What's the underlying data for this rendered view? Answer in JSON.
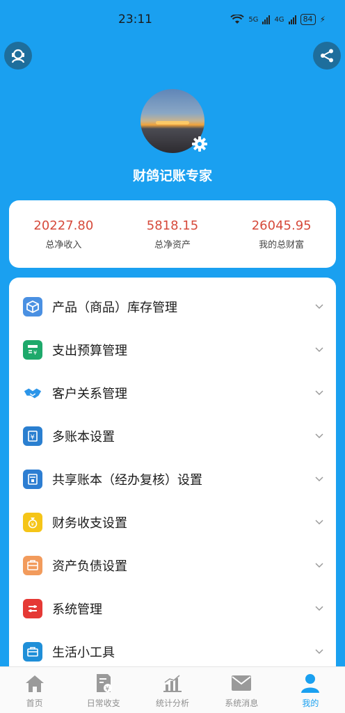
{
  "status_bar": {
    "time": "23:11",
    "net1": "5G",
    "net2": "4G",
    "battery": "84"
  },
  "profile": {
    "name": "财鸽记账专家"
  },
  "stats": [
    {
      "value": "20227.80",
      "label": "总净收入"
    },
    {
      "value": "5818.15",
      "label": "总净资产"
    },
    {
      "value": "26045.95",
      "label": "我的总财富"
    }
  ],
  "menu": [
    {
      "label": "产品（商品）库存管理",
      "icon": "cube-icon",
      "color": "#4a90e2"
    },
    {
      "label": "支出预算管理",
      "icon": "budget-icon",
      "color": "#1ea96b"
    },
    {
      "label": "客户关系管理",
      "icon": "handshake-icon",
      "color": "#2b95e9"
    },
    {
      "label": "多账本设置",
      "icon": "ledger-icon",
      "color": "#2a7fd0"
    },
    {
      "label": "共享账本（经办复核）设置",
      "icon": "shared-ledger-icon",
      "color": "#2d7ed2"
    },
    {
      "label": "财务收支设置",
      "icon": "money-bag-icon",
      "color": "#f5c518"
    },
    {
      "label": "资产负债设置",
      "icon": "asset-icon",
      "color": "#f29b5c"
    },
    {
      "label": "系统管理",
      "icon": "system-icon",
      "color": "#e53935"
    },
    {
      "label": "生活小工具",
      "icon": "toolbox-icon",
      "color": "#1f8fd8"
    }
  ],
  "nav": [
    {
      "label": "首页",
      "icon": "home-icon"
    },
    {
      "label": "日常收支",
      "icon": "bill-icon"
    },
    {
      "label": "统计分析",
      "icon": "chart-icon"
    },
    {
      "label": "系统消息",
      "icon": "mail-icon"
    },
    {
      "label": "我的",
      "icon": "user-icon",
      "active": true
    }
  ],
  "colors": {
    "header_bg": "#1aa0f0",
    "stat_value": "#d64a3b",
    "active_tab": "#1aa0f0"
  }
}
